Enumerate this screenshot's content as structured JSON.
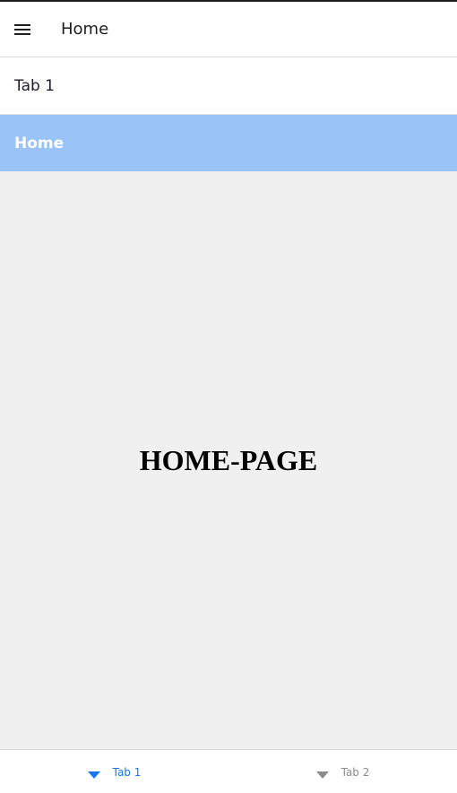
{
  "header": {
    "title": "Home",
    "menu_icon": "hamburger-menu-icon"
  },
  "menu": {
    "items": [
      {
        "label": "Tab 1",
        "active": false
      },
      {
        "label": "Home",
        "active": true
      }
    ]
  },
  "main": {
    "heading": "HOME-PAGE"
  },
  "bottom_nav": {
    "tabs": [
      {
        "label": "Tab 1",
        "icon": "triangle-down-icon",
        "active": true,
        "color": "#1976f0"
      },
      {
        "label": "Tab 2",
        "icon": "triangle-down-icon",
        "active": false,
        "color": "#8c8c8c"
      }
    ]
  },
  "colors": {
    "active_menu_bg": "#9ac3f8",
    "content_bg": "#f1f0f0",
    "accent": "#1976f0"
  }
}
